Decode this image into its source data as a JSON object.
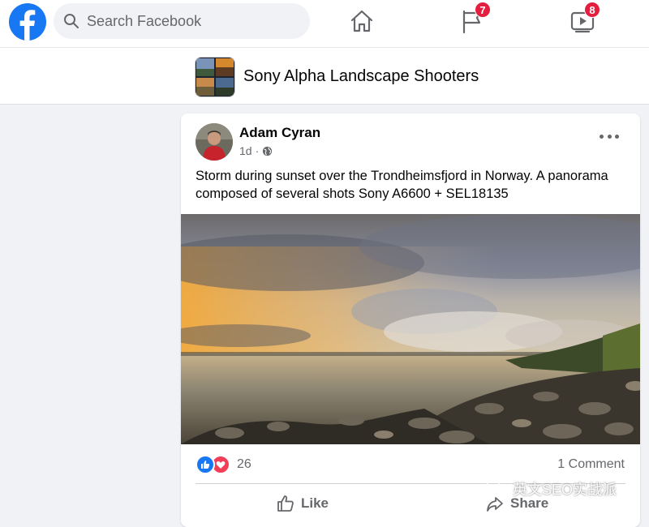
{
  "header": {
    "search": {
      "placeholder": "Search Facebook"
    },
    "nav": {
      "home_icon": "home-icon",
      "pages_icon": "flag-icon",
      "pages_badge": "7",
      "watch_icon": "video-play-icon",
      "watch_badge": "8"
    }
  },
  "group": {
    "name": "Sony Alpha Landscape Shooters"
  },
  "post": {
    "author": "Adam Cyran",
    "time": "1d",
    "privacy_icon": "globe-icon",
    "text": "Storm during sunset over the Trondheimsfjord in Norway. A panorama composed of several shots Sony A6600 + SEL18135",
    "reaction_icons": [
      "like-reaction-icon",
      "love-reaction-icon"
    ],
    "reaction_count": "26",
    "comment_count": "1 Comment",
    "actions": {
      "like": "Like",
      "share": "Share"
    }
  },
  "watermark": {
    "text": "英文SEO实战派"
  },
  "colors": {
    "brand": "#1877f2",
    "badge": "#e41e3f",
    "love": "#f33e58",
    "background": "#f0f2f5"
  }
}
